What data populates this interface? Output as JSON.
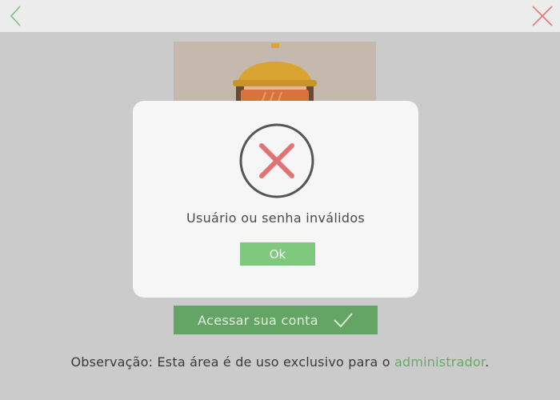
{
  "topbar": {
    "back_icon": "chevron-left-icon",
    "close_icon": "close-icon"
  },
  "hero": {
    "illustration": "construction-worker-hard-hat"
  },
  "form": {
    "submit_label": "Acessar sua conta",
    "submit_icon": "check-icon"
  },
  "note": {
    "prefix": "Observação: Esta área é de uso exclusivo para o ",
    "link": "administrador",
    "suffix": "."
  },
  "dialog": {
    "icon": "error-x-icon",
    "message": "Usuário ou senha inválidos",
    "ok_label": "Ok"
  },
  "colors": {
    "accent_green": "#64a565",
    "ok_green": "#7fc97f",
    "error_red": "#e07474",
    "overlay": "#cbcbcb"
  }
}
